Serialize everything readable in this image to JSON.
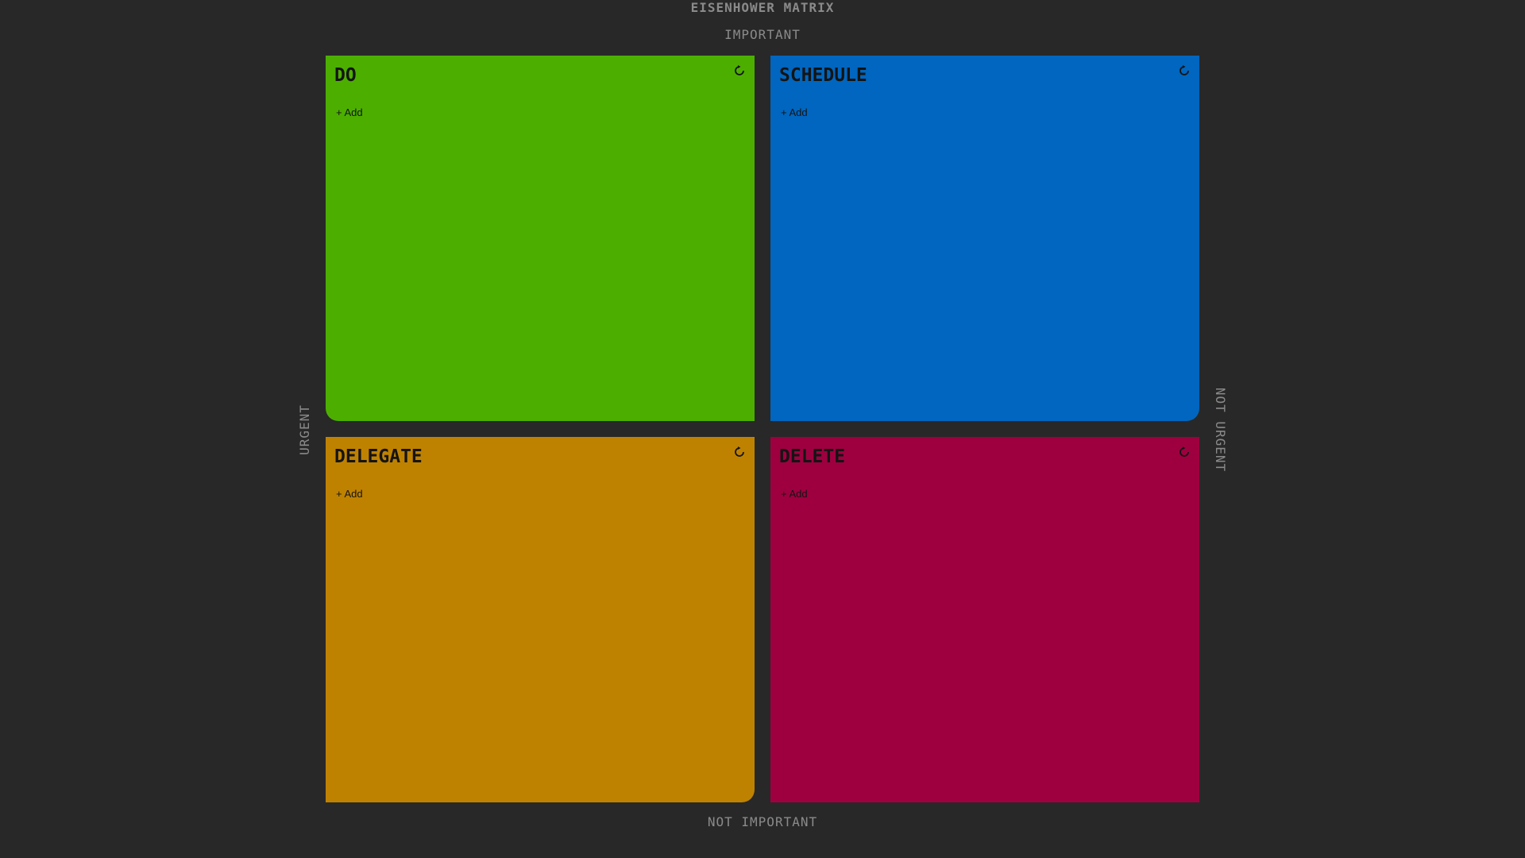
{
  "app": {
    "title": "EISENHOWER MATRIX"
  },
  "axes": {
    "top": "IMPORTANT",
    "bottom": "NOT IMPORTANT",
    "left": "URGENT",
    "right": "NOT URGENT"
  },
  "quadrants": [
    {
      "key": "do",
      "title": "DO",
      "color": "#4caf00",
      "add_label": "+ Add",
      "reset_icon": "reset-icon"
    },
    {
      "key": "schedule",
      "title": "SCHEDULE",
      "color": "#0066bf",
      "add_label": "+ Add",
      "reset_icon": "reset-icon"
    },
    {
      "key": "delegate",
      "title": "DELEGATE",
      "color": "#bf8200",
      "add_label": "+ Add",
      "reset_icon": "reset-icon"
    },
    {
      "key": "delete",
      "title": "DELETE",
      "color": "#9e003f",
      "add_label": "+ Add",
      "reset_icon": "reset-icon"
    }
  ]
}
